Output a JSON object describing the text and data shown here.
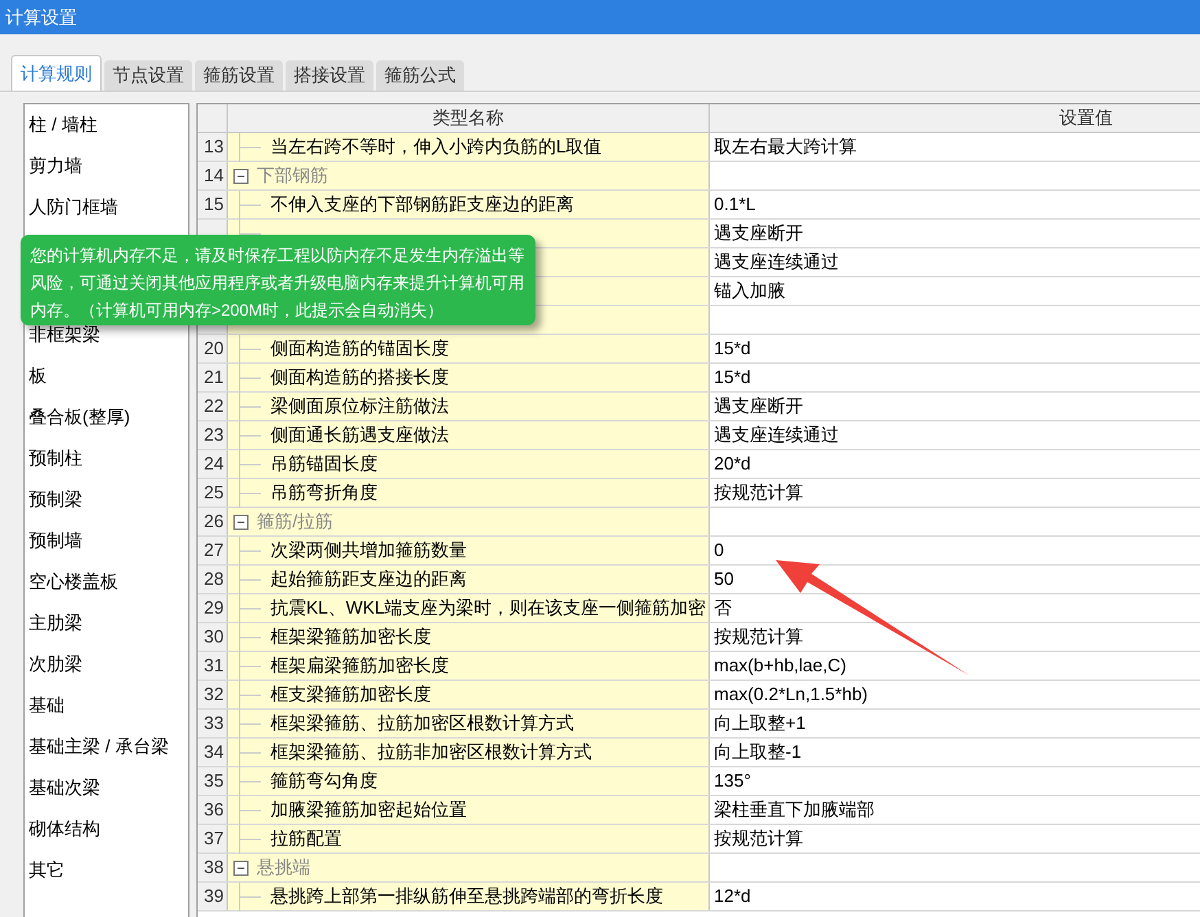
{
  "window": {
    "title": "计算设置"
  },
  "tabs": [
    {
      "label": "计算规则",
      "selected": true
    },
    {
      "label": "节点设置",
      "selected": false
    },
    {
      "label": "箍筋设置",
      "selected": false
    },
    {
      "label": "搭接设置",
      "selected": false
    },
    {
      "label": "箍筋公式",
      "selected": false
    }
  ],
  "sidebar": {
    "items": [
      {
        "label": "柱 / 墙柱"
      },
      {
        "label": "剪力墙"
      },
      {
        "label": "人防门框墙"
      },
      {
        "label": "非框架梁"
      },
      {
        "label": "板"
      },
      {
        "label": "叠合板(整厚)"
      },
      {
        "label": "预制柱"
      },
      {
        "label": "预制梁"
      },
      {
        "label": "预制墙"
      },
      {
        "label": "空心楼盖板"
      },
      {
        "label": "主肋梁"
      },
      {
        "label": "次肋梁"
      },
      {
        "label": "基础"
      },
      {
        "label": "基础主梁 / 承台梁"
      },
      {
        "label": "基础次梁"
      },
      {
        "label": "砌体结构"
      },
      {
        "label": "其它"
      }
    ]
  },
  "table": {
    "columns": [
      "类型名称",
      "设置值"
    ],
    "rows": [
      {
        "kind": "item",
        "number": "13",
        "name": "当左右跨不等时，伸入小跨内负筋的L取值",
        "value": "取左右最大跨计算"
      },
      {
        "kind": "group",
        "number": "14",
        "name": "下部钢筋",
        "expanded": true
      },
      {
        "kind": "item",
        "number": "15",
        "name": "不伸入支座的下部钢筋距支座边的距离",
        "value": "0.1*L"
      },
      {
        "kind": "item",
        "value": "遇支座断开"
      },
      {
        "kind": "item",
        "value": "遇支座连续通过"
      },
      {
        "kind": "item",
        "value": "锚入加腋"
      },
      {
        "kind": "group"
      },
      {
        "kind": "item",
        "number": "20",
        "name": "侧面构造筋的锚固长度",
        "value": "15*d"
      },
      {
        "kind": "item",
        "number": "21",
        "name": "侧面构造筋的搭接长度",
        "value": "15*d"
      },
      {
        "kind": "item",
        "number": "22",
        "name": "梁侧面原位标注筋做法",
        "value": "遇支座断开"
      },
      {
        "kind": "item",
        "number": "23",
        "name": "侧面通长筋遇支座做法",
        "value": "遇支座连续通过"
      },
      {
        "kind": "item",
        "number": "24",
        "name": "吊筋锚固长度",
        "value": "20*d"
      },
      {
        "kind": "item",
        "number": "25",
        "name": "吊筋弯折角度",
        "value": "按规范计算"
      },
      {
        "kind": "group",
        "number": "26",
        "name": "箍筋/拉筋",
        "expanded": true
      },
      {
        "kind": "item",
        "number": "27",
        "name": "次梁两侧共增加箍筋数量",
        "value": "0"
      },
      {
        "kind": "item",
        "number": "28",
        "name": "起始箍筋距支座边的距离",
        "value": "50"
      },
      {
        "kind": "item",
        "number": "29",
        "name": "抗震KL、WKL端支座为梁时，则在该支座一侧箍筋加密",
        "value": "否"
      },
      {
        "kind": "item",
        "number": "30",
        "name": "框架梁箍筋加密长度",
        "value": "按规范计算"
      },
      {
        "kind": "item",
        "number": "31",
        "name": "框架扁梁箍筋加密长度",
        "value": "max(b+hb,lae,C)"
      },
      {
        "kind": "item",
        "number": "32",
        "name": "框支梁箍筋加密长度",
        "value": "max(0.2*Ln,1.5*hb)"
      },
      {
        "kind": "item",
        "number": "33",
        "name": "框架梁箍筋、拉筋加密区根数计算方式",
        "value": "向上取整+1"
      },
      {
        "kind": "item",
        "number": "34",
        "name": "框架梁箍筋、拉筋非加密区根数计算方式",
        "value": "向上取整-1"
      },
      {
        "kind": "item",
        "number": "35",
        "name": "箍筋弯勾角度",
        "value": "135°"
      },
      {
        "kind": "item",
        "number": "36",
        "name": "加腋梁箍筋加密起始位置",
        "value": "梁柱垂直下加腋端部"
      },
      {
        "kind": "item",
        "number": "37",
        "name": "拉筋配置",
        "value": "按规范计算"
      },
      {
        "kind": "group",
        "number": "38",
        "name": "悬挑端",
        "expanded": true
      },
      {
        "kind": "item",
        "number": "39",
        "name": "悬挑跨上部第一排纵筋伸至悬挑跨端部的弯折长度",
        "value": "12*d"
      }
    ]
  },
  "notice": {
    "text": "您的计算机内存不足，请及时保存工程以防内存不足发生内存溢出等风险，可通过关闭其他应用程序或者升级电脑内存来提升计算机可用内存。（计算机可用内存>200M时，此提示会自动消失）"
  }
}
